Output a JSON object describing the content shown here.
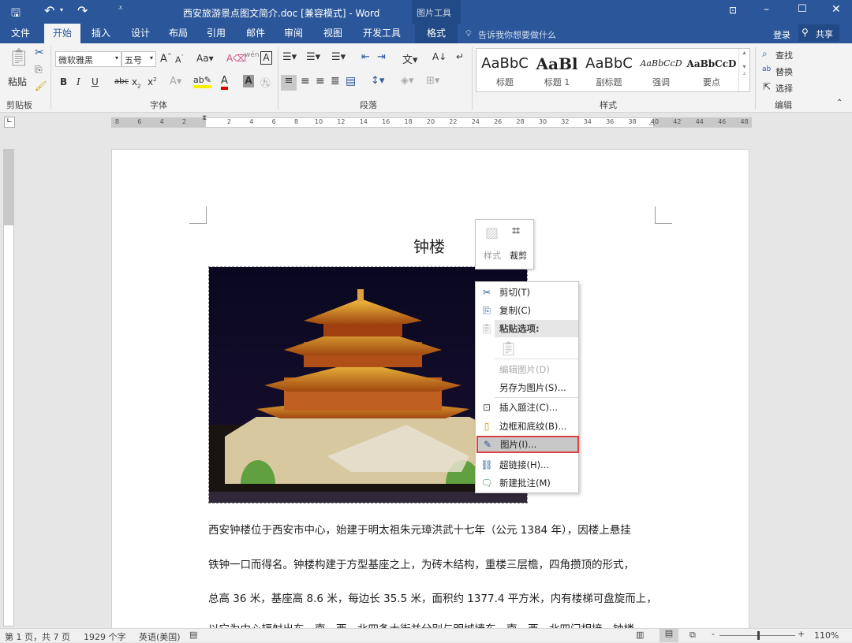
{
  "window": {
    "title": "西安旅游景点图文简介.doc [兼容模式] - Word",
    "context_tab_group": "图片工具"
  },
  "tabs": [
    "文件",
    "开始",
    "插入",
    "设计",
    "布局",
    "引用",
    "邮件",
    "审阅",
    "视图",
    "开发工具",
    "格式"
  ],
  "tell_me": "告诉我你想要做什么",
  "account": {
    "login": "登录",
    "share": "共享"
  },
  "ribbon": {
    "clipboard": {
      "paste": "粘贴",
      "label": "剪贴板"
    },
    "font": {
      "name": "微软雅黑",
      "size": "五号",
      "label": "字体",
      "bold": "B",
      "italic": "I",
      "underline": "U",
      "strike": "abc"
    },
    "paragraph": {
      "label": "段落"
    },
    "styles": {
      "label": "样式",
      "items": [
        {
          "preview": "AaBbC",
          "name": "标题"
        },
        {
          "preview": "AaBl",
          "name": "标题 1"
        },
        {
          "preview": "AaBbC",
          "name": "副标题"
        },
        {
          "preview": "AaBbCcD",
          "name": "强调"
        },
        {
          "preview": "AaBbCcD",
          "name": "要点"
        }
      ]
    },
    "editing": {
      "label": "编辑",
      "find": "查找",
      "replace": "替换",
      "select": "选择"
    }
  },
  "ruler": {
    "left": [
      "8",
      "6",
      "4",
      "2"
    ],
    "main": [
      "2",
      "4",
      "6",
      "8",
      "10",
      "12",
      "14",
      "16",
      "18",
      "20",
      "22",
      "24",
      "26",
      "28",
      "30",
      "32",
      "34",
      "36",
      "38"
    ],
    "right": [
      "40",
      "42",
      "44",
      "46",
      "48"
    ]
  },
  "document": {
    "heading": "钟楼",
    "paragraphs": [
      "西安钟楼位于西安市中心，始建于明太祖朱元璋洪武十七年（公元 1384 年），因楼上悬挂",
      "铁钟一口而得名。钟楼构建于方型基座之上，为砖木结构，重楼三层檐，四角攒顶的形式，",
      "总高 36 米，基座高 8.6 米，每边长 35.5 米，面积约 1377.4 平方米，内有楼梯可盘旋而上，",
      "以它为中心辐射出东、南、西、北四条大街并分别与明城墙东、南、西、北四门相接，钟楼"
    ]
  },
  "mini_toolbar": {
    "style": "样式",
    "crop": "裁剪"
  },
  "context_menu": {
    "items": [
      {
        "label": "剪切(T)",
        "icon": "scissors-icon"
      },
      {
        "label": "复制(C)",
        "icon": "copy-icon"
      },
      {
        "label": "粘贴选项:",
        "icon": "paste-icon"
      },
      {
        "label": "编辑图片(D)",
        "icon": ""
      },
      {
        "label": "另存为图片(S)...",
        "icon": ""
      },
      {
        "label": "插入题注(C)...",
        "icon": "caption-icon"
      },
      {
        "label": "边框和底纹(B)...",
        "icon": "border-icon"
      },
      {
        "label": "图片(I)...",
        "icon": "picture-format-icon"
      },
      {
        "label": "超链接(H)...",
        "icon": "hyperlink-icon"
      },
      {
        "label": "新建批注(M)",
        "icon": "comment-icon"
      }
    ],
    "highlighted": "图片(I)...",
    "highlight_color": "#e04040"
  },
  "status": {
    "page": "第 1 页，共 7 页",
    "words": "1929 个字",
    "language": "英语(美国)",
    "zoom": "110%",
    "zoom_level_percent": 110
  },
  "colors": {
    "brand": "#2b579a"
  }
}
